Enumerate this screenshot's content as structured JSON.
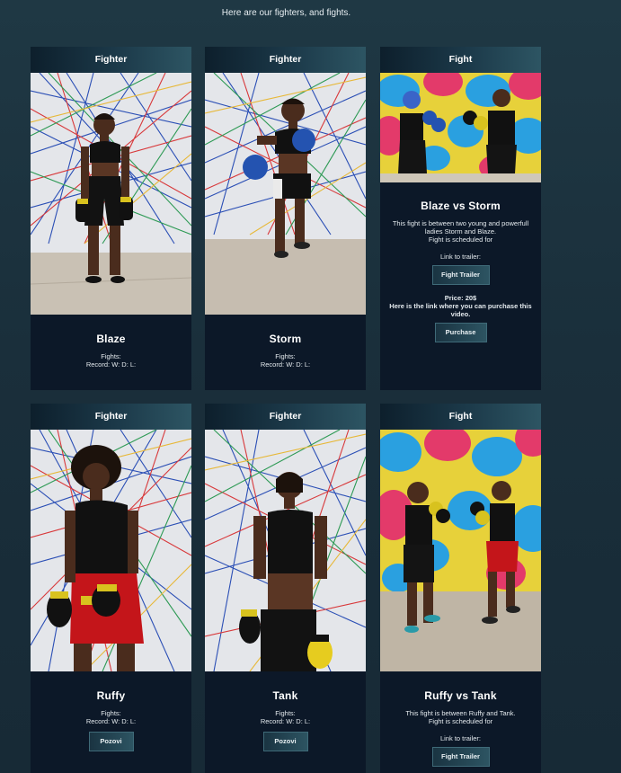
{
  "intro": "Here are our fighters, and fights.",
  "cards": {
    "blaze": {
      "header": "Fighter",
      "name": "Blaze",
      "fights": "Fights:",
      "record": "Record: W: D: L:"
    },
    "storm": {
      "header": "Fighter",
      "name": "Storm",
      "fights": "Fights:",
      "record": "Record: W: D: L:"
    },
    "fight1": {
      "header": "Fight",
      "title": "Blaze vs Storm",
      "desc_line1": "This fight is between two young and powerfull",
      "desc_line2": "ladies Storm and Blaze.",
      "desc_line3": "Fight is scheduled for",
      "trailer_label": "Link to trailer:",
      "trailer_button": "Fight Trailer",
      "price": "Price: 20$",
      "purchase_text": "Here is the link where you can purchase this video.",
      "purchase_button": "Purchase"
    },
    "ruffy": {
      "header": "Fighter",
      "name": "Ruffy",
      "fights": "Fights:",
      "record": "Record: W: D: L:",
      "button": "Pozovi"
    },
    "tank": {
      "header": "Fighter",
      "name": "Tank",
      "fights": "Fights:",
      "record": "Record: W: D: L:",
      "button": "Pozovi"
    },
    "fight2": {
      "header": "Fight",
      "title": "Ruffy vs Tank",
      "desc_line1": "This fight is between Ruffy and Tank.",
      "desc_line2": "Fight is scheduled for",
      "trailer_label": "Link to trailer:",
      "trailer_button": "Fight Trailer"
    }
  },
  "colors": {
    "page_bg": "#1c3541",
    "card_bg": "#0c1828",
    "accent": "#2d5563"
  }
}
